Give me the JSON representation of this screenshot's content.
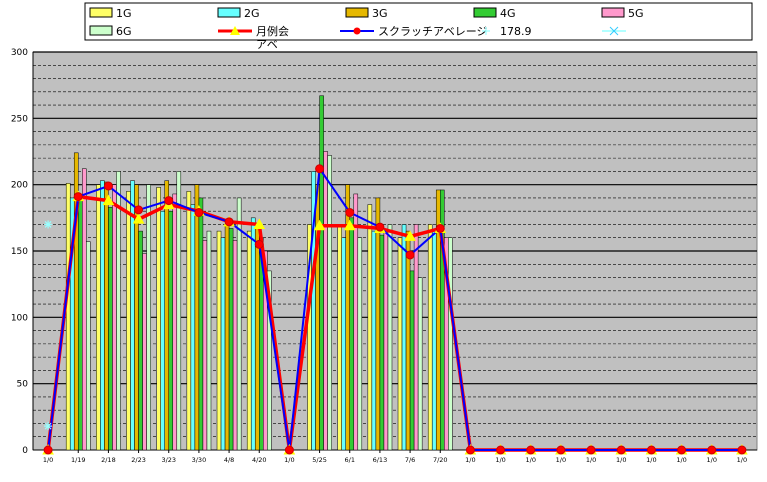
{
  "chart_data": {
    "type": "bar",
    "categories": [
      "1/0",
      "1/19",
      "2/18",
      "2/23",
      "3/23",
      "3/30",
      "4/8",
      "4/20",
      "1/0",
      "5/25",
      "6/1",
      "6/13",
      "7/6",
      "7/20",
      "1/0",
      "1/0",
      "1/0",
      "1/0",
      "1/0",
      "1/0",
      "1/0",
      "1/0",
      "1/0",
      "1/0"
    ],
    "ylim": [
      0,
      300
    ],
    "yticks": [
      0,
      50,
      100,
      150,
      200,
      250,
      300
    ],
    "grid": true,
    "legend_position": "top",
    "legend_labels": [
      "1G",
      "2G",
      "3G",
      "4G",
      "5G",
      "6G",
      "月例会アベ",
      "スクラッチアベレージ",
      "178.9",
      ""
    ],
    "bar_series": [
      {
        "name": "1G",
        "color": "#ffff66",
        "values": [
          0,
          201,
          200,
          195,
          198,
          195,
          165,
          165,
          0,
          170,
          170,
          185,
          160,
          170,
          0,
          0,
          0,
          0,
          0,
          0,
          0,
          0,
          0,
          0
        ]
      },
      {
        "name": "2G",
        "color": "#66ffff",
        "values": [
          0,
          190,
          203,
          203,
          180,
          185,
          160,
          175,
          0,
          210,
          160,
          165,
          170,
          165,
          0,
          0,
          0,
          0,
          0,
          0,
          0,
          0,
          0,
          0
        ]
      },
      {
        "name": "3G",
        "color": "#e6b800",
        "values": [
          0,
          224,
          202,
          200,
          203,
          200,
          170,
          168,
          0,
          200,
          200,
          190,
          165,
          196,
          0,
          0,
          0,
          0,
          0,
          0,
          0,
          0,
          0,
          0
        ]
      },
      {
        "name": "4G",
        "color": "#33cc33",
        "values": [
          0,
          188,
          183,
          165,
          180,
          190,
          167,
          160,
          0,
          267,
          175,
          162,
          135,
          196,
          0,
          0,
          0,
          0,
          0,
          0,
          0,
          0,
          0,
          0
        ]
      },
      {
        "name": "5G",
        "color": "#ff99cc",
        "values": [
          0,
          212,
          200,
          148,
          193,
          158,
          158,
          150,
          0,
          225,
          193,
          166,
          170,
          160,
          0,
          0,
          0,
          0,
          0,
          0,
          0,
          0,
          0,
          0
        ]
      },
      {
        "name": "6G",
        "color": "#ccffcc",
        "values": [
          0,
          157,
          210,
          200,
          210,
          165,
          190,
          135,
          0,
          222,
          160,
          170,
          130,
          160,
          0,
          0,
          0,
          0,
          0,
          0,
          0,
          0,
          0,
          0
        ]
      }
    ],
    "line_series": [
      {
        "name": "月例会アベ",
        "color": "#ff0000",
        "marker": "triangle",
        "marker_color": "#ffff00",
        "values": [
          0,
          191,
          188,
          174,
          185,
          180,
          172,
          170,
          0,
          169,
          169,
          167,
          161,
          167,
          0,
          0,
          0,
          0,
          0,
          0,
          0,
          0,
          0,
          0
        ]
      },
      {
        "name": "スクラッチアベレージ",
        "color": "#0000ff",
        "marker": "circle",
        "marker_color": "#ff0000",
        "values": [
          0,
          191,
          199,
          181,
          188,
          179,
          172,
          155,
          0,
          212,
          179,
          168,
          147,
          167,
          0,
          0,
          0,
          0,
          0,
          0,
          0,
          0,
          0,
          0
        ]
      }
    ],
    "points_178_9": [
      {
        "x": "1/0",
        "y": 170
      },
      {
        "x": "1/0",
        "y": 18
      }
    ]
  }
}
